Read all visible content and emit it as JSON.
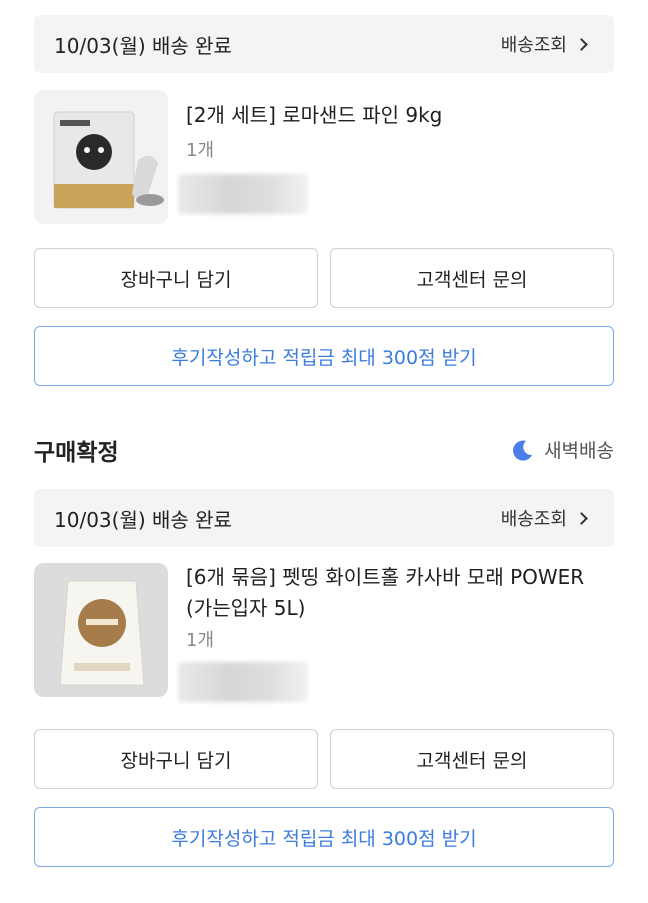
{
  "orders": [
    {
      "delivery_status": "10/03(월)  배송 완료",
      "track_label": "배송조회",
      "product_name": "[2개 세트] 로마샌드 파인 9kg",
      "quantity": "1개",
      "buttons": {
        "cart": "장바구니 담기",
        "support": "고객센터 문의",
        "review": "후기작성하고 적립금 최대 300점 받기"
      }
    },
    {
      "delivery_status": "10/03(월)  배송 완료",
      "track_label": "배송조회",
      "product_name": "[6개 묶음] 펫띵 화이트홀 카사바 모래 POWER (가는입자 5L)",
      "quantity": "1개",
      "buttons": {
        "cart": "장바구니 담기",
        "support": "고객센터 문의",
        "review": "후기작성하고 적립금 최대 300점 받기"
      }
    }
  ],
  "section": {
    "title": "구매확정",
    "dawn_delivery": "새벽배송"
  },
  "colors": {
    "accent": "#3c7ce0",
    "moon": "#4a7de8"
  },
  "icons": {
    "chevron": "chevron-right-icon",
    "moon": "moon-icon"
  }
}
